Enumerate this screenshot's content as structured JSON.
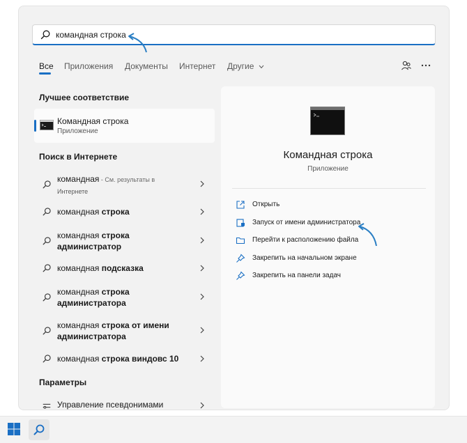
{
  "search": {
    "query_part1": "командная",
    "query_part2": "строка"
  },
  "tabs": [
    {
      "label": "Все",
      "active": true
    },
    {
      "label": "Приложения"
    },
    {
      "label": "Документы"
    },
    {
      "label": "Интернет"
    },
    {
      "label": "Другие"
    }
  ],
  "toolbar_icons": [
    "people-icon",
    "more-icon"
  ],
  "best_match": {
    "heading": "Лучшее соответствие",
    "title_part1": "Командная",
    "title_part2": "строка",
    "subtitle": "Приложение"
  },
  "web_search": {
    "heading": "Поиск в Интернете",
    "items": [
      {
        "normal": "командная",
        "bold": "",
        "normal2": "",
        "hint": " - См. результаты в",
        "line2_small": "Интернете"
      },
      {
        "normal": "командная ",
        "bold": "строка",
        "normal2": ""
      },
      {
        "normal": "командная ",
        "bold": "строка",
        "normal2": "",
        "line2_bold": "администратор"
      },
      {
        "normal": "командная ",
        "bold": "подсказка",
        "normal2": ""
      },
      {
        "normal": "командная ",
        "bold": "строка",
        "normal2": "",
        "line2_bold": "администратора"
      },
      {
        "normal": "командная ",
        "bold": "строка от имени",
        "normal2": "",
        "line2_bold": "администратора"
      },
      {
        "normal": "командная ",
        "bold": "строка виндовс 10",
        "normal2": ""
      }
    ]
  },
  "settings": {
    "heading": "Параметры",
    "item": "Управление псевдонимами"
  },
  "detail": {
    "title": "Командная строка",
    "subtitle": "Приложение",
    "actions": [
      {
        "label": "Открыть",
        "icon": "open-icon"
      },
      {
        "label": "Запуск от имени администратора",
        "icon": "shield-icon"
      },
      {
        "label": "Перейти к расположению файла",
        "icon": "folder-icon"
      },
      {
        "label": "Закрепить на начальном экране",
        "icon": "pin-icon"
      },
      {
        "label": "Закрепить на панели задач",
        "icon": "pin-icon"
      }
    ]
  },
  "colors": {
    "accent": "#1a6fc4",
    "annotation_arrow": "#2b7fc4"
  }
}
